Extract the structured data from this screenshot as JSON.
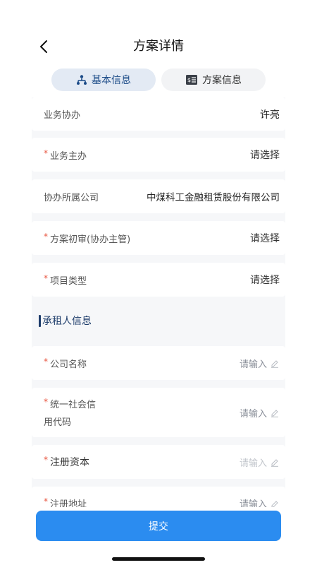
{
  "header": {
    "title": "方案详情",
    "tabs": [
      {
        "label": "基本信息",
        "icon": "org-chart-icon"
      },
      {
        "label": "方案信息",
        "icon": "document-icon"
      }
    ]
  },
  "form": {
    "rows": [
      {
        "label": "业务协办",
        "value": "许亮",
        "required": false
      },
      {
        "label": "业务主办",
        "value": "请选择",
        "required": true
      },
      {
        "label": "协办所属公司",
        "value": "中煤科工金融租赁股份有限公司",
        "required": false
      },
      {
        "label": "方案初审(协办主管)",
        "value": "请选择",
        "required": true
      },
      {
        "label": "项目类型",
        "value": "请选择",
        "required": true
      }
    ],
    "section_title": "承租人信息",
    "inputs": [
      {
        "label": "公司名称",
        "placeholder": "请输入",
        "required": true
      },
      {
        "label_line1": "统一社会信",
        "label_line2": "用代码",
        "placeholder": "请输入",
        "required": true
      },
      {
        "label": "注册资本",
        "placeholder": "请输入",
        "required": true
      },
      {
        "label": "注册地址",
        "placeholder": "请输入",
        "required": true
      }
    ],
    "required_mark": "*"
  },
  "footer": {
    "submit_label": "提交"
  },
  "colors": {
    "accent": "#2b8cf0",
    "tab_active_bg": "#e3eaf4",
    "section_color": "#1e3d6b",
    "required": "#e8543f"
  }
}
